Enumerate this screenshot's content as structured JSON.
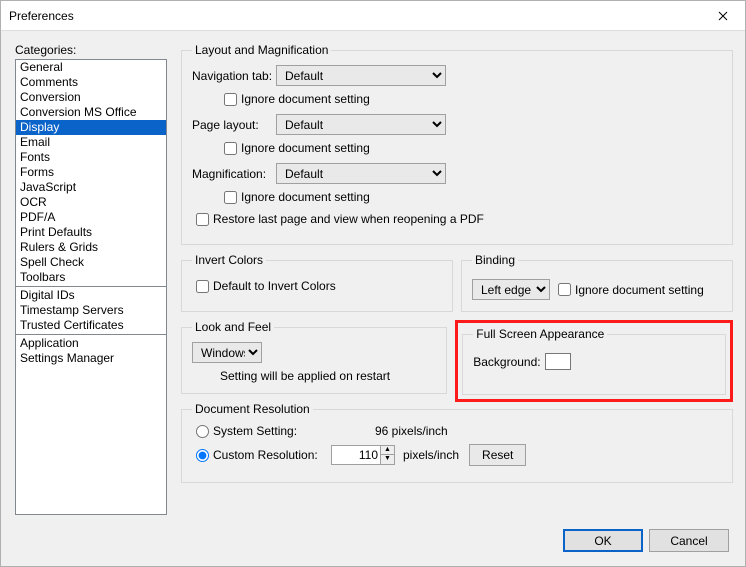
{
  "window": {
    "title": "Preferences"
  },
  "categories_label": "Categories:",
  "categories_groups": [
    [
      "General",
      "Comments",
      "Conversion",
      "Conversion MS Office",
      "Display",
      "Email",
      "Fonts",
      "Forms",
      "JavaScript",
      "OCR",
      "PDF/A",
      "Print Defaults",
      "Rulers & Grids",
      "Spell Check",
      "Toolbars"
    ],
    [
      "Digital IDs",
      "Timestamp Servers",
      "Trusted Certificates"
    ],
    [
      "Application",
      "Settings Manager"
    ]
  ],
  "selected_category": "Display",
  "layout_mag": {
    "legend": "Layout and Magnification",
    "nav_label": "Navigation tab:",
    "nav_value": "Default",
    "page_label": "Page layout:",
    "page_value": "Default",
    "mag_label": "Magnification:",
    "mag_value": "Default",
    "ignore_label": "Ignore document setting",
    "restore_label": "Restore last page and view when reopening a PDF"
  },
  "invert_colors": {
    "legend": "Invert Colors",
    "default_label": "Default to Invert Colors"
  },
  "binding": {
    "legend": "Binding",
    "value": "Left edge",
    "ignore_label": "Ignore document setting"
  },
  "look_feel": {
    "legend": "Look and Feel",
    "value": "Windows",
    "note": "Setting will be applied on restart"
  },
  "fullscreen": {
    "legend": "Full Screen Appearance",
    "bg_label": "Background:",
    "bg_color": "#000000"
  },
  "doc_res": {
    "legend": "Document Resolution",
    "system_label": "System Setting:",
    "system_value": "96 pixels/inch",
    "custom_label": "Custom Resolution:",
    "custom_value": "110",
    "unit": "pixels/inch",
    "reset_label": "Reset"
  },
  "footer": {
    "ok": "OK",
    "cancel": "Cancel"
  }
}
